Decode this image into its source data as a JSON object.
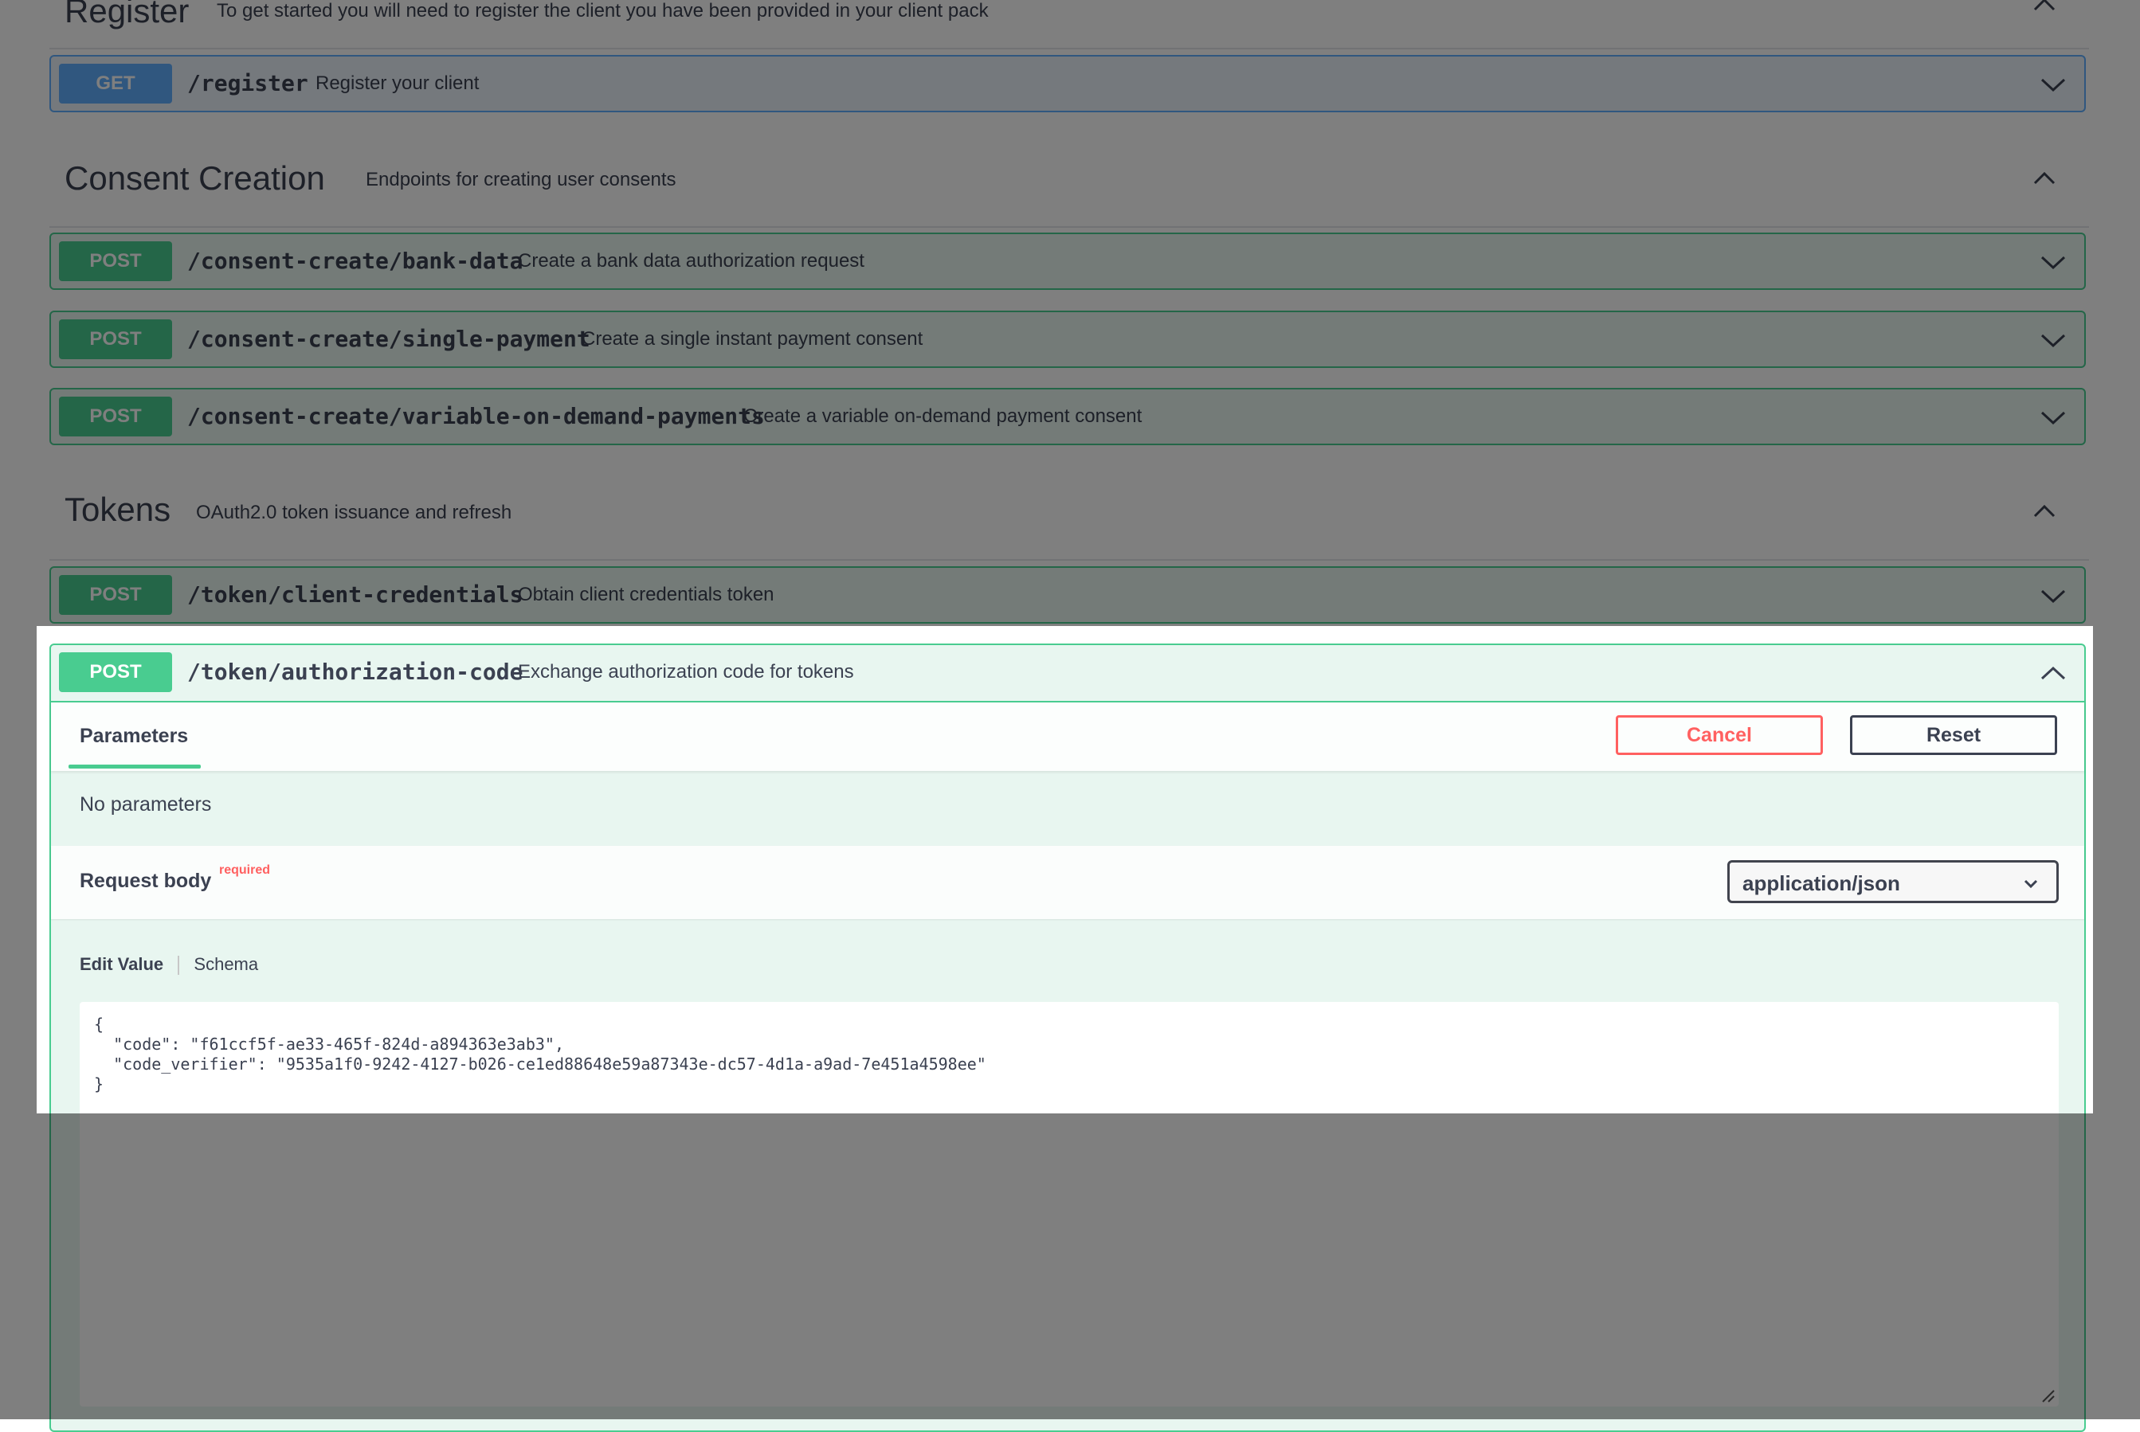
{
  "register": {
    "title": "Register",
    "description": "To get started you will need to register the client you have been provided in your client pack",
    "operation": {
      "method": "GET",
      "path": "/register",
      "summary": "Register your client"
    }
  },
  "consent": {
    "title": "Consent Creation",
    "description": "Endpoints for creating user consents",
    "operations": [
      {
        "method": "POST",
        "path": "/consent-create/bank-data",
        "summary": "Create a bank data authorization request"
      },
      {
        "method": "POST",
        "path": "/consent-create/single-payment",
        "summary": "Create a single instant payment consent"
      },
      {
        "method": "POST",
        "path": "/consent-create/variable-on-demand-payments",
        "summary": "Create a variable on-demand payment consent"
      }
    ]
  },
  "tokens": {
    "title": "Tokens",
    "description": "OAuth2.0 token issuance and refresh",
    "operations": [
      {
        "method": "POST",
        "path": "/token/client-credentials",
        "summary": "Obtain client credentials token"
      },
      {
        "method": "POST",
        "path": "/token/authorization-code",
        "summary": "Exchange authorization code for tokens"
      }
    ]
  },
  "expanded": {
    "parameters_tab": "Parameters",
    "cancel_label": "Cancel",
    "reset_label": "Reset",
    "no_parameters": "No parameters",
    "request_body_label": "Request body",
    "required_label": "required",
    "content_type": "application/json",
    "edit_value_tab": "Edit Value",
    "schema_tab": "Schema",
    "code_line_1": "{",
    "code_line_2": "  \"code\": \"f61ccf5f-ae33-465f-824d-a894363e3ab3\",",
    "code_line_3": "  \"code_verifier\": \"9535a1f0-9242-4127-b026-ce1ed88648e59a87343e-dc57-4d1a-a9ad-7e451a4598ee\"",
    "code_line_4": "}"
  },
  "colors": {
    "get": "#61affe",
    "post": "#49cc90",
    "cancel": "#ff6060",
    "overlay": "rgba(0,0,0,0.5)"
  }
}
